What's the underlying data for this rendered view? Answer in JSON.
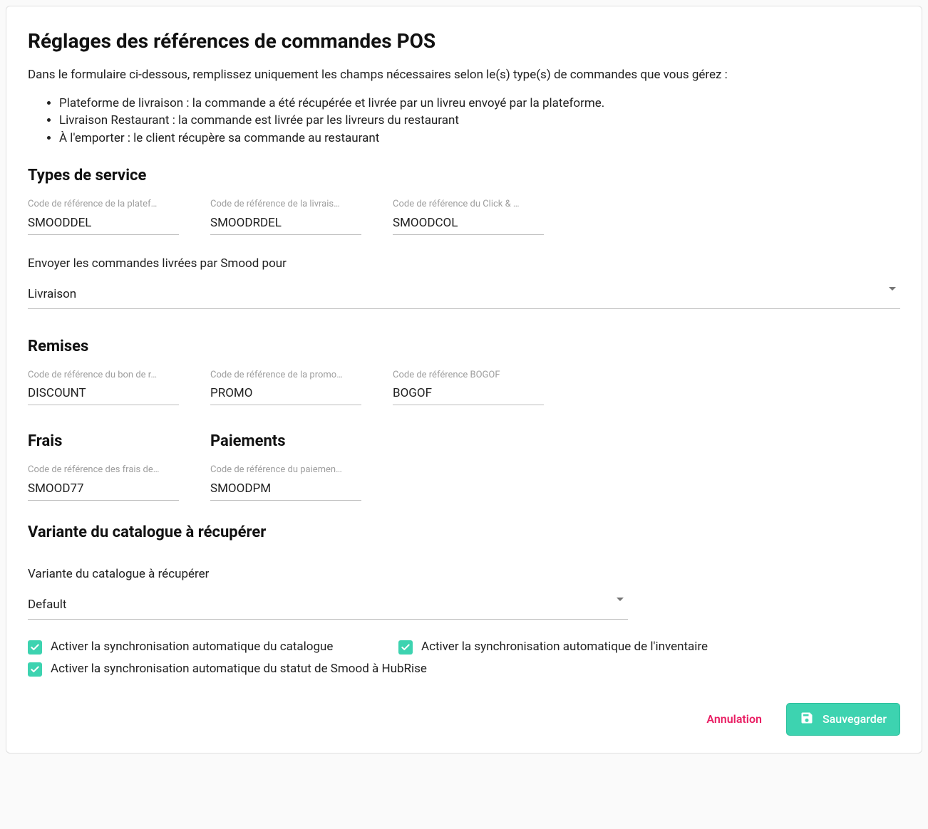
{
  "header": {
    "title": "Réglages des références de commandes POS",
    "intro": "Dans le formulaire ci-dessous, remplissez uniquement les champs nécessaires selon le(s) type(s) de commandes que vous gérez :",
    "bullets": [
      "Plateforme de livraison : la commande a été récupérée et livrée par un livreu envoyé par la plateforme.",
      "Livraison Restaurant : la commande est livrée par les livreurs du restaurant",
      "À l'emporter : le client récupère sa commande au restaurant"
    ]
  },
  "service_types": {
    "heading": "Types de service",
    "platform": {
      "label": "Code de référence de la platef…",
      "value": "SMOODDEL"
    },
    "restaurant": {
      "label": "Code de référence de la livrais…",
      "value": "SMOODRDEL"
    },
    "click": {
      "label": "Code de référence du Click & …",
      "value": "SMOODCOL"
    },
    "send_orders": {
      "label": "Envoyer les commandes livrées par Smood pour",
      "value": "Livraison"
    }
  },
  "discounts": {
    "heading": "Remises",
    "coupon": {
      "label": "Code de référence du bon de r…",
      "value": "DISCOUNT"
    },
    "promo": {
      "label": "Code de référence de la promo…",
      "value": "PROMO"
    },
    "bogof": {
      "label": "Code de référence BOGOF",
      "value": "BOGOF"
    }
  },
  "fees": {
    "heading": "Frais",
    "delivery": {
      "label": "Code de référence des frais de…",
      "value": "SMOOD77"
    }
  },
  "payments": {
    "heading": "Paiements",
    "payment": {
      "label": "Code de référence du paiemen…",
      "value": "SMOODPM"
    }
  },
  "variant": {
    "heading": "Variante du catalogue à récupérer",
    "select": {
      "label": "Variante du catalogue à récupérer",
      "value": "Default"
    }
  },
  "checkboxes": {
    "catalog": "Activer la synchronisation automatique du catalogue",
    "inventory": "Activer la synchronisation automatique de l'inventaire",
    "status": "Activer la synchronisation automatique du statut de Smood à HubRise"
  },
  "actions": {
    "cancel": "Annulation",
    "save": "Sauvegarder"
  }
}
